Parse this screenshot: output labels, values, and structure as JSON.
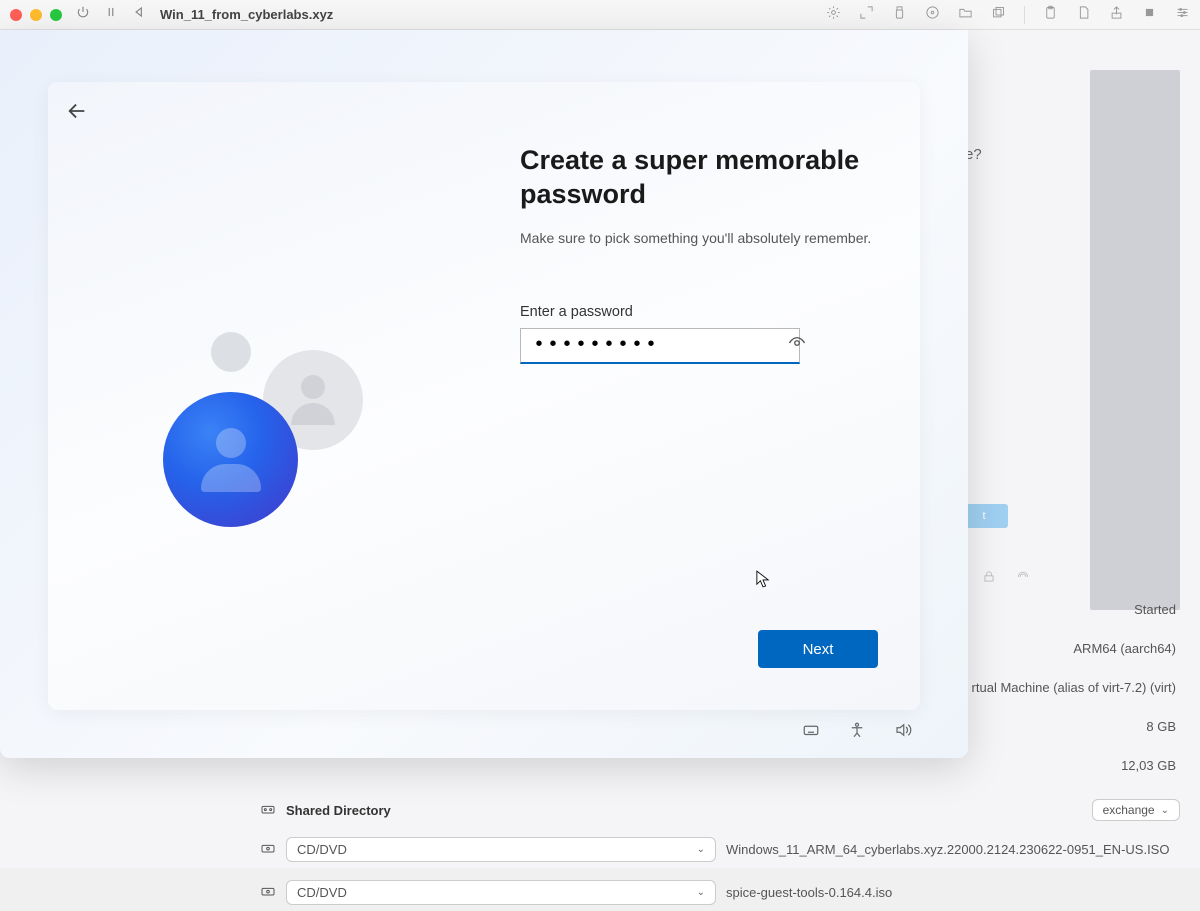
{
  "host_toolbar": {
    "vm_title": "Win_11_from_cyberlabs.xyz"
  },
  "oobe": {
    "title": "Create a super memorable password",
    "subtitle": "Make sure to pick something you'll absolutely remember.",
    "field_label": "Enter a password",
    "password_value": "•••••••••",
    "next_label": "Next"
  },
  "host_info": {
    "status": "Started",
    "arch": "ARM64 (aarch64)",
    "machine": "rtual Machine (alias of virt-7.2) (virt)",
    "memory": "8 GB",
    "disk": "12,03 GB"
  },
  "shared": {
    "label": "Shared Directory",
    "value": "exchange"
  },
  "devices": {
    "cd1_label": "CD/DVD",
    "cd1_value": "Windows_11_ARM_64_cyberlabs.xyz.22000.2124.230622-0951_EN-US.ISO",
    "cd2_label": "CD/DVD",
    "cd2_value": "spice-guest-tools-0.164.4.iso"
  },
  "bg_partial": {
    "text": "e?",
    "btn": "t"
  }
}
